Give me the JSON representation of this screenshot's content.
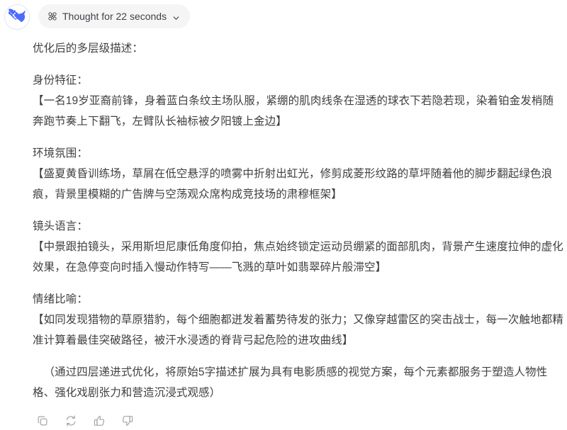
{
  "assistant": {
    "avatar_icon": "deepseek-whale-logo",
    "avatar_color": "#4D6BFE"
  },
  "thinking": {
    "icon": "thinking-network-icon",
    "label": "Thought for 22 seconds",
    "chevron_icon": "chevron-down-icon",
    "expanded": false
  },
  "message": {
    "intro": "优化后的多层级描述：",
    "sections": [
      {
        "title": "身份特征：",
        "body": "【一名19岁亚裔前锋，身着蓝白条纹主场队服，紧绷的肌肉线条在湿透的球衣下若隐若现，染着铂金发梢随奔跑节奏上下翻飞，左臂队长袖标被夕阳镀上金边】"
      },
      {
        "title": "环境氛围：",
        "body": "【盛夏黄昏训练场，草屑在低空悬浮的喷雾中折射出虹光，修剪成菱形纹路的草坪随着他的脚步翻起绿色浪痕，背景里模糊的广告牌与空荡观众席构成竞技场的肃穆框架】"
      },
      {
        "title": "镜头语言：",
        "body": "【中景跟拍镜头，采用斯坦尼康低角度仰拍，焦点始终锁定运动员绷紧的面部肌肉，背景产生速度拉伸的虚化效果，在急停变向时插入慢动作特写——飞溅的草叶如翡翠碎片般滞空】"
      },
      {
        "title": "情绪比喻：",
        "body": "【如同发现猎物的草原猎豹，每个细胞都迸发着蓄势待发的张力；又像穿越雷区的突击战士，每一次触地都精准计算着最佳突破路径，被汗水浸透的脊背弓起危险的进攻曲线】"
      }
    ],
    "summary": "（通过四层递进式优化，将原始5字描述扩展为具有电影质感的视觉方案，每个元素都服务于塑造人物性格、强化戏剧张力和营造沉浸式观感）"
  },
  "actions": [
    {
      "name": "copy-button",
      "icon": "copy-icon"
    },
    {
      "name": "regenerate-button",
      "icon": "refresh-icon"
    },
    {
      "name": "thumbs-up-button",
      "icon": "thumbs-up-icon"
    },
    {
      "name": "thumbs-down-button",
      "icon": "thumbs-down-icon"
    }
  ]
}
